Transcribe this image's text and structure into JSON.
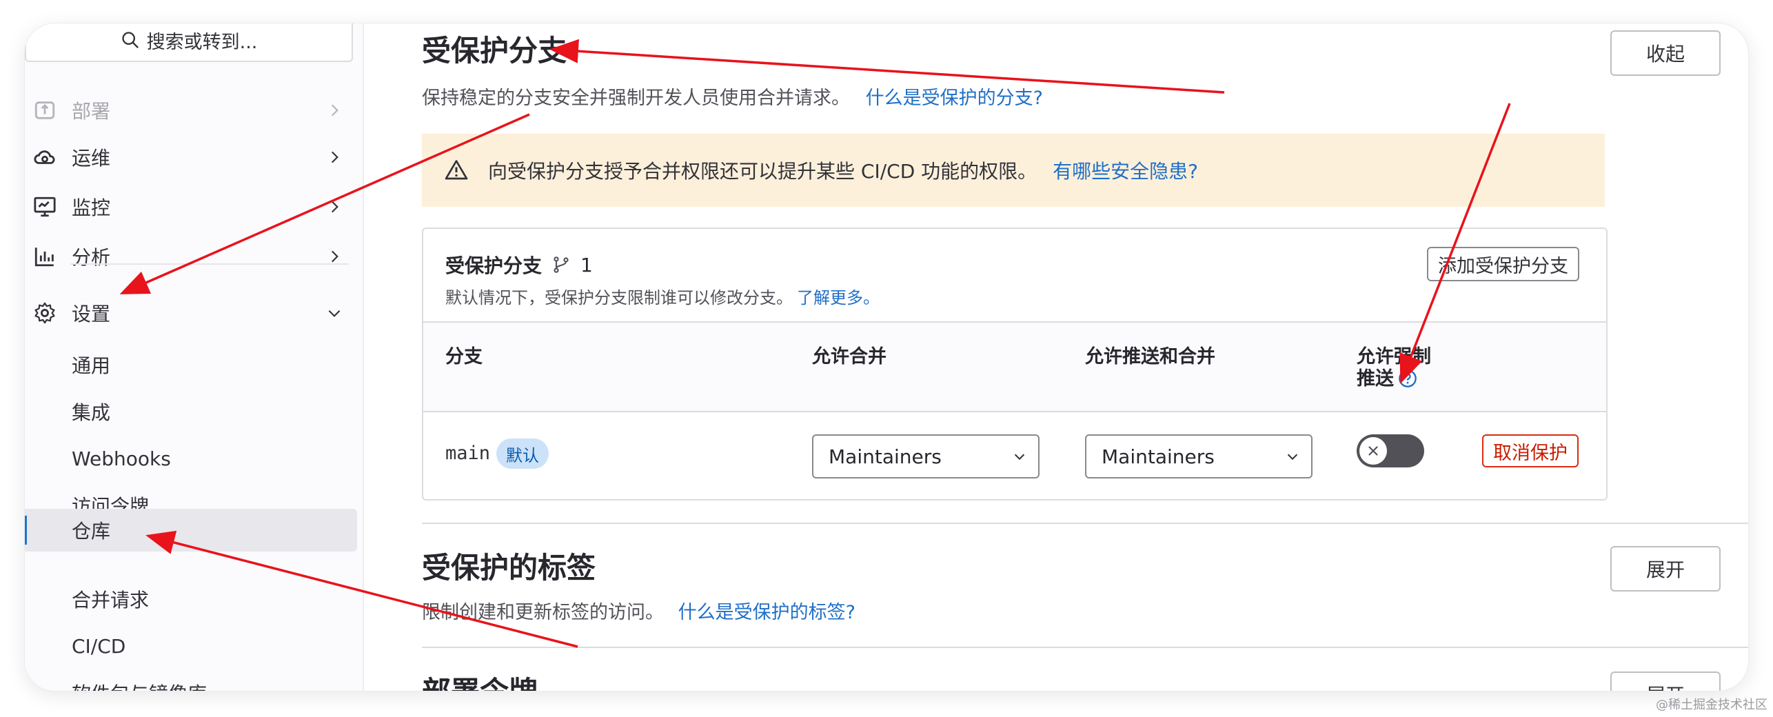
{
  "sidebar": {
    "search_placeholder": "搜索或转到...",
    "items": [
      {
        "label": "部署",
        "icon": "deploy-icon",
        "state": "faded"
      },
      {
        "label": "运维",
        "icon": "cloud-ops-icon"
      },
      {
        "label": "监控",
        "icon": "monitor-icon"
      },
      {
        "label": "分析",
        "icon": "analytics-icon"
      },
      {
        "label": "设置",
        "icon": "gear-icon",
        "expanded": true
      }
    ],
    "settings_children": [
      {
        "label": "通用"
      },
      {
        "label": "集成"
      },
      {
        "label": "Webhooks"
      },
      {
        "label": "访问令牌"
      },
      {
        "label": "仓库",
        "active": true
      },
      {
        "label": "合并请求"
      },
      {
        "label": "CI/CD"
      },
      {
        "label": "软件包与镜像库"
      }
    ]
  },
  "protected_branches": {
    "title": "受保护分支",
    "description": "保持稳定的分支安全并强制开发人员使用合并请求。",
    "help_link": "什么是受保护的分支?",
    "collapse_label": "收起",
    "alert": {
      "text": "向受保护分支授予合并权限还可以提升某些 CI/CD 功能的权限。",
      "link": "有哪些安全隐患?"
    },
    "card": {
      "title": "受保护分支",
      "count": "1",
      "description": "默认情况下，受保护分支限制谁可以修改分支。",
      "learn_more": "了解更多。",
      "add_button": "添加受保护分支",
      "columns": {
        "branch": "分支",
        "allowed_to_merge": "允许合并",
        "allowed_to_push": "允许推送和合并",
        "force_push_line1": "允许强制",
        "force_push_line2": "推送"
      },
      "rows": [
        {
          "branch": "main",
          "badge": "默认",
          "merge": "Maintainers",
          "push": "Maintainers",
          "force_push": false,
          "unprotect_label": "取消保护"
        }
      ]
    }
  },
  "protected_tags": {
    "title": "受保护的标签",
    "description": "限制创建和更新标签的访问。",
    "help_link": "什么是受保护的标签?",
    "expand_label": "展开"
  },
  "deploy_tokens": {
    "title": "部署令牌",
    "expand_label": "展开"
  },
  "watermark": "@稀土掘金技术社区",
  "colors": {
    "link": "#1f6fc7",
    "alert_bg": "#fcf0db",
    "badge_bg": "#cbe2f9",
    "danger": "#dd2b0e",
    "annotation_arrow": "#e8131b"
  }
}
